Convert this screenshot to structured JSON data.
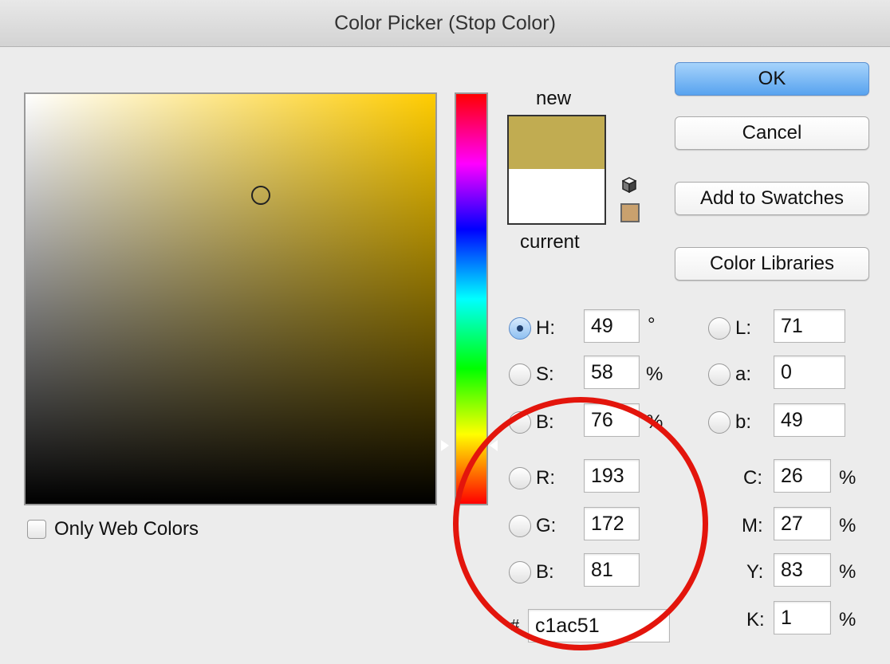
{
  "window": {
    "title": "Color Picker (Stop Color)"
  },
  "colors": {
    "new": "#c1ac51",
    "current": "#ffffff",
    "field_hue": "#ffcc00",
    "swatch_chip": "#c9a16e",
    "annotation": "#e3150c"
  },
  "preview": {
    "new_label": "new",
    "current_label": "current"
  },
  "icons": {
    "gamut_warning": "cube-icon",
    "web_safe": "swatch-chip"
  },
  "buttons": {
    "ok": "OK",
    "cancel": "Cancel",
    "add_to_swatches": "Add to Swatches",
    "color_libraries": "Color Libraries"
  },
  "hsb": {
    "h": {
      "label": "H:",
      "value": "49",
      "unit": "°",
      "selected": true
    },
    "s": {
      "label": "S:",
      "value": "58",
      "unit": "%"
    },
    "b": {
      "label": "B:",
      "value": "76",
      "unit": "%"
    }
  },
  "rgb": {
    "r": {
      "label": "R:",
      "value": "193"
    },
    "g": {
      "label": "G:",
      "value": "172"
    },
    "b": {
      "label": "B:",
      "value": "81"
    }
  },
  "lab": {
    "l": {
      "label": "L:",
      "value": "71"
    },
    "a": {
      "label": "a:",
      "value": "0"
    },
    "b": {
      "label": "b:",
      "value": "49"
    }
  },
  "cmyk": {
    "c": {
      "label": "C:",
      "value": "26",
      "unit": "%"
    },
    "m": {
      "label": "M:",
      "value": "27",
      "unit": "%"
    },
    "y": {
      "label": "Y:",
      "value": "83",
      "unit": "%"
    },
    "k": {
      "label": "K:",
      "value": "1",
      "unit": "%"
    }
  },
  "hex": {
    "prefix": "#",
    "value": "c1ac51"
  },
  "only_web_colors": {
    "label": "Only Web Colors",
    "checked": false
  }
}
